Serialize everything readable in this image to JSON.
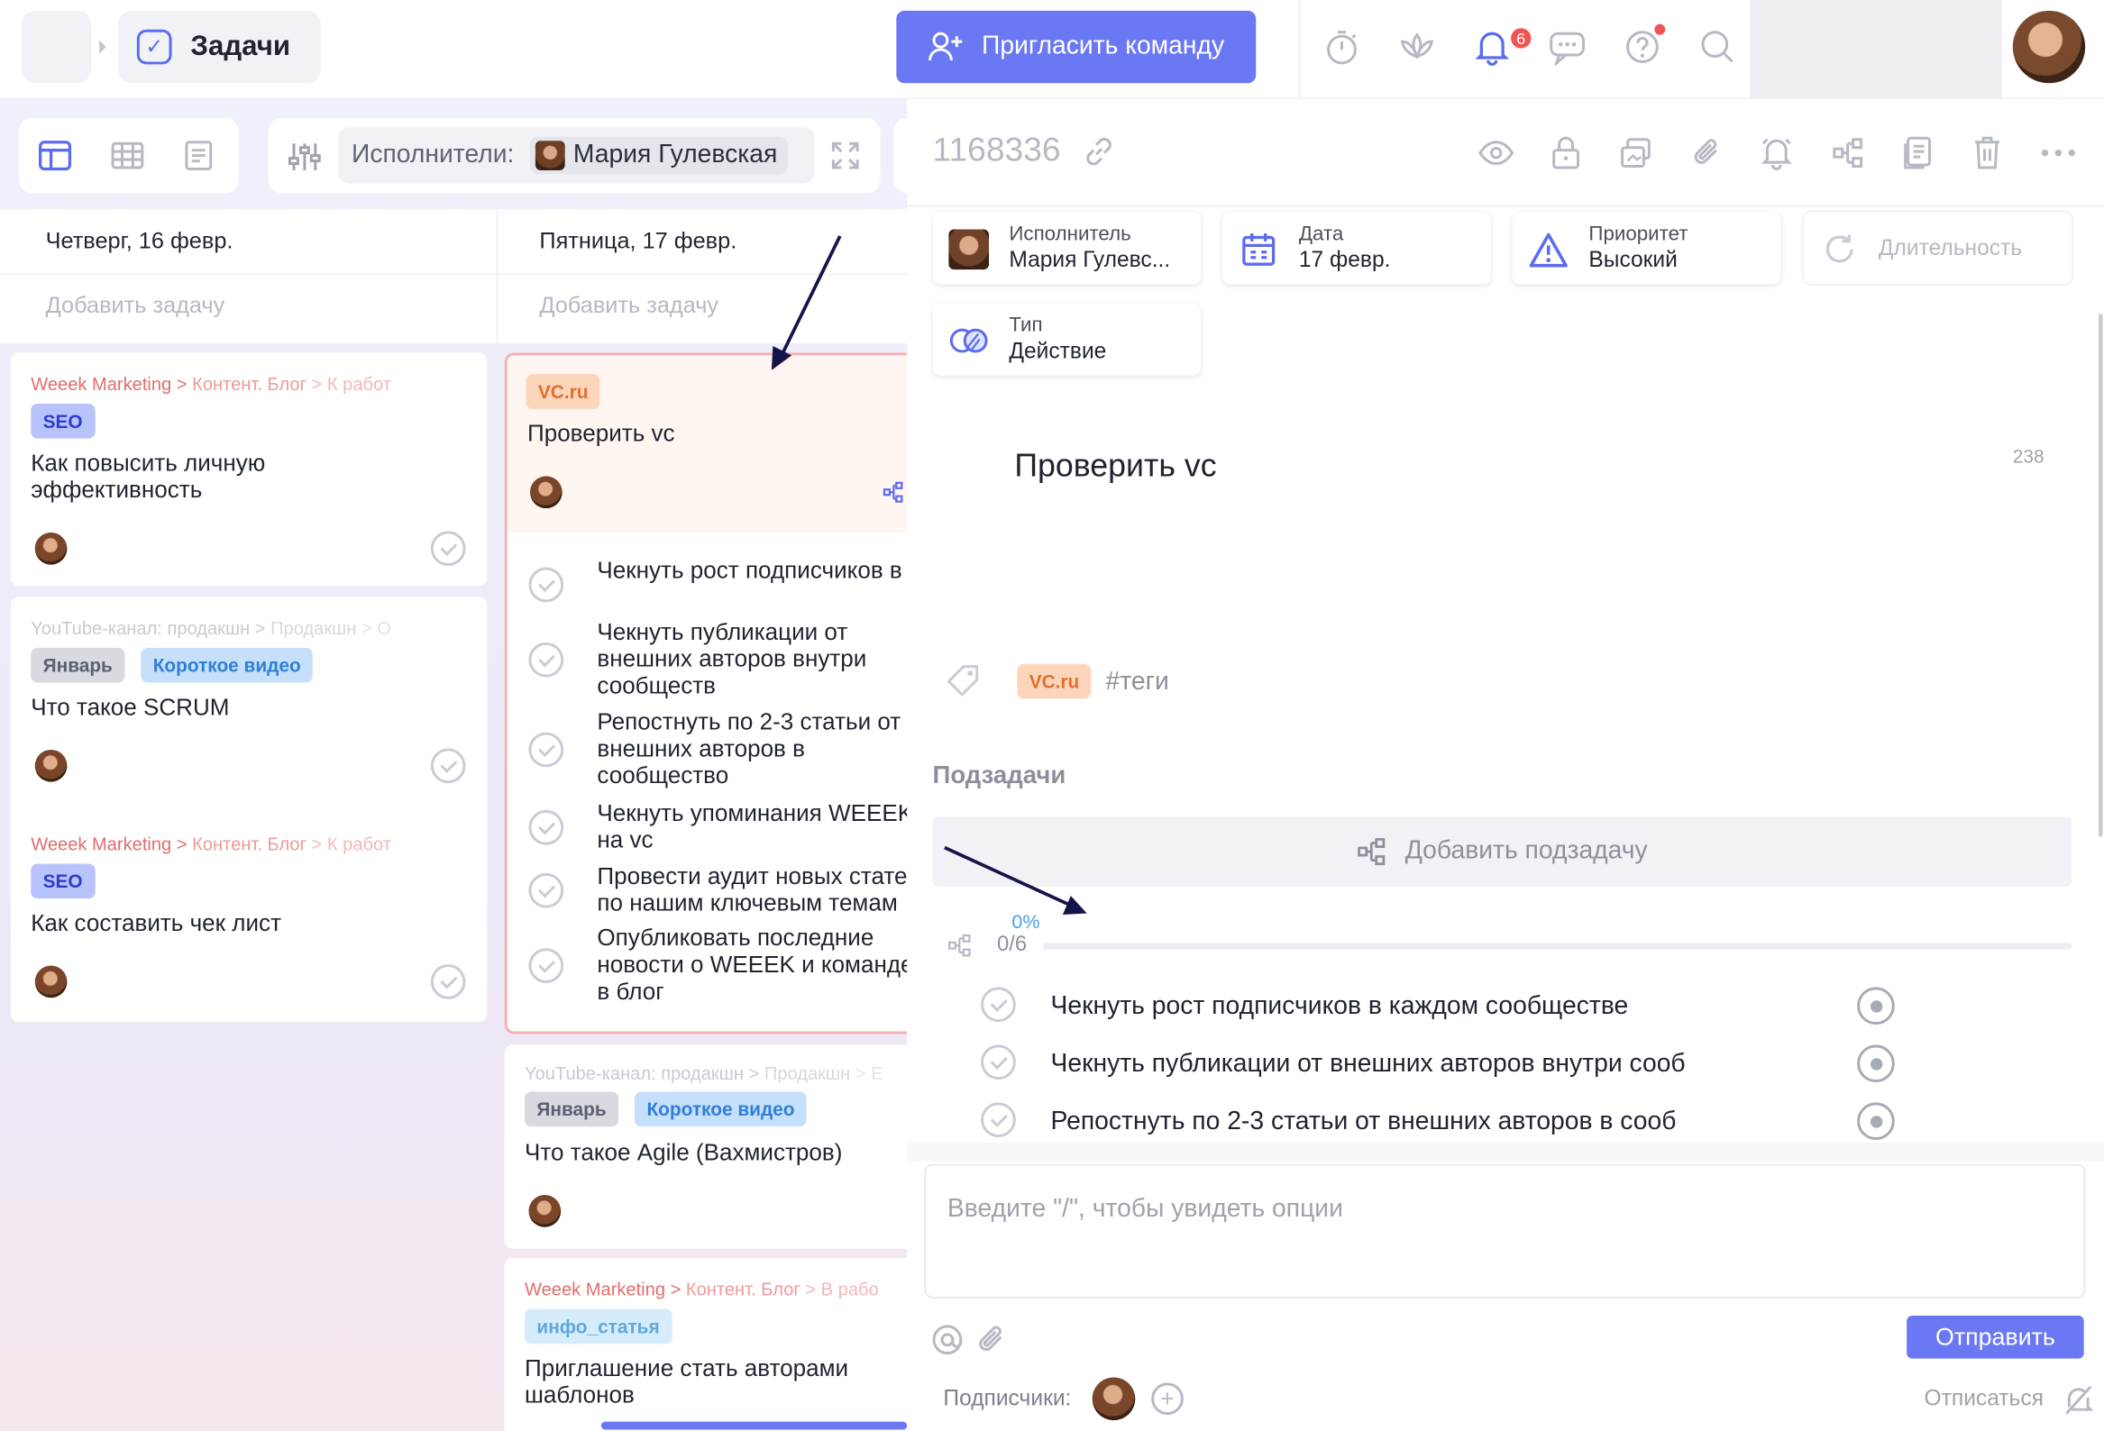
{
  "app": {
    "section_title": "Задачи",
    "invite_button": "Пригласить команду",
    "notifications_count": "6"
  },
  "toolbar": {
    "filter_label": "Исполнители:",
    "filter_assignee": "Мария Гулевская"
  },
  "columns": [
    {
      "title": "Четверг, 16 февр.",
      "add_task": "Добавить задачу"
    },
    {
      "title": "Пятница, 17 февр.",
      "add_task": "Добавить задачу"
    }
  ],
  "cards_col1": [
    {
      "crumb": [
        "Weeek Marketing",
        "Контент. Блог",
        "К работ"
      ],
      "tags": [
        "SEO"
      ],
      "title": "Как повысить личную эффективность"
    },
    {
      "crumb": [
        "YouTube-канал: продакшн",
        "Продакшн",
        "О"
      ],
      "tags": [
        "Январь",
        "Короткое видео"
      ],
      "title": "Что такое SCRUM"
    },
    {
      "crumb": [
        "Weeek Marketing",
        "Контент. Блог",
        "К работ"
      ],
      "tags": [
        "SEO"
      ],
      "title": "Как составить чек лист"
    }
  ],
  "card_vc": {
    "tag": "VC.ru",
    "title": "Проверить vc",
    "subtasks": [
      "Чекнуть рост подписчиков в каждом сообществе",
      "Чекнуть публикации от внешних авторов внутри сообществ",
      "Репостнуть по 2-3 статьи от внешних авторов в сообщество",
      "Чекнуть упоминания WEEEK на vc",
      "Провести аудит новых статей по нашим ключевым темам",
      "Опубликовать последние новости о WEEEK и команде в блог"
    ]
  },
  "cards_col2": [
    {
      "crumb": [
        "YouTube-канал: продакшн",
        "Продакшн",
        "Е"
      ],
      "tags": [
        "Январь",
        "Короткое видео"
      ],
      "title": "Что такое Agile (Вахмистров)"
    },
    {
      "crumb": [
        "Weeek Marketing",
        "Контент. Блог",
        "В рабо"
      ],
      "tags": [
        "инфо_статья"
      ],
      "title": "Приглашение стать авторами шаблонов"
    }
  ],
  "panel": {
    "task_id": "1168336",
    "props": {
      "assignee_label": "Исполнитель",
      "assignee_value": "Мария Гулевс...",
      "date_label": "Дата",
      "date_value": "17 февр.",
      "priority_label": "Приоритет",
      "priority_value": "Высокий",
      "duration_label": "Длительность",
      "type_label": "Тип",
      "type_value": "Действие"
    },
    "title": "Проверить vc",
    "char_count": "238",
    "tag": "VC.ru",
    "tags_placeholder": "#теги",
    "subtasks_heading": "Подзадачи",
    "add_subtask": "Добавить подзадачу",
    "progress_percent": "0%",
    "progress_count": "0/6",
    "progress_fraction": 0,
    "subtasks": [
      "Чекнуть рост подписчиков в каждом сообществе",
      "Чекнуть публикации от внешних авторов внутри сооб",
      "Репостнуть по 2-3 статьи от внешних авторов в сооб"
    ],
    "comment_placeholder": "Введите \"/\", чтобы увидеть опции",
    "send_button": "Отправить",
    "subscribers_label": "Подписчики:",
    "unsubscribe": "Отписаться"
  },
  "colors": {
    "accent": "#6b78f3",
    "danger": "#f05454",
    "progress": "#4ba0e0"
  }
}
